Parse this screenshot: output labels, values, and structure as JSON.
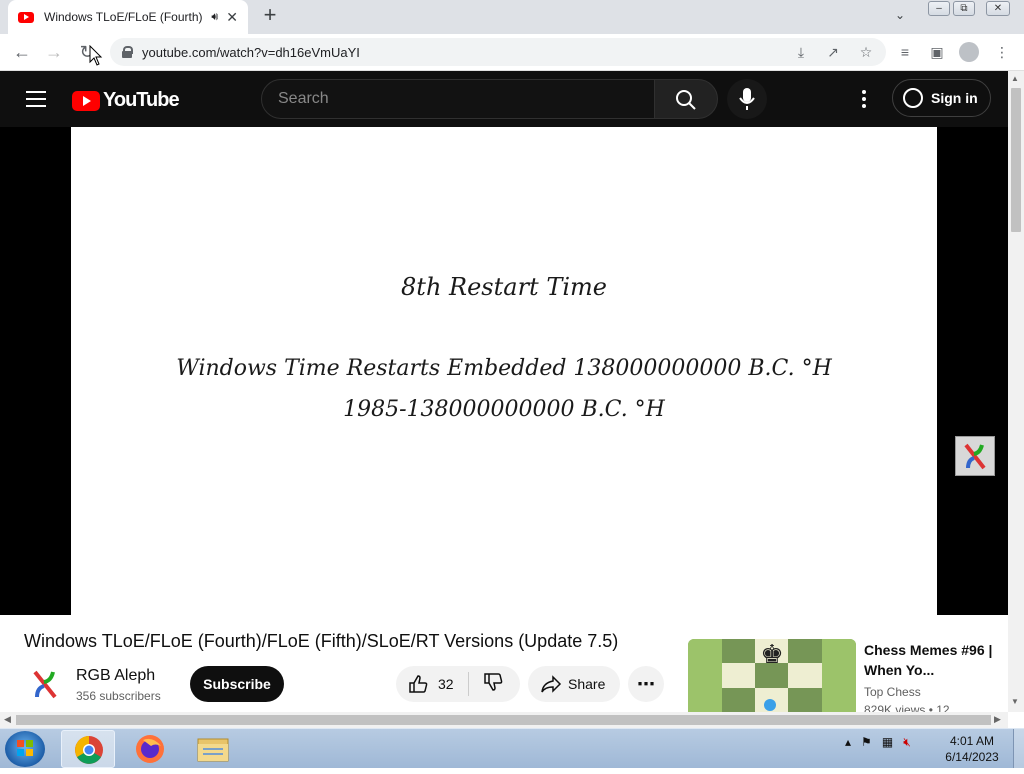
{
  "browser": {
    "tab_title": "Windows TLoE/FLoE (Fourth)",
    "new_tab": "+",
    "url": "youtube.com/watch?v=dh16eVmUaYI"
  },
  "youtube": {
    "logo_text": "YouTube",
    "search_placeholder": "Search",
    "sign_in": "Sign in",
    "brand_color": "#ff0000"
  },
  "video": {
    "slide_line1": "8th Restart Time",
    "slide_line2": "Windows Time Restarts Embedded 138000000000 B.C. °H",
    "slide_line3": "1985-138000000000 B.C. °H",
    "title": "Windows TLoE/FLoE (Fourth)/FLoE (Fifth)/SLoE/RT Versions (Update 7.5)",
    "channel_name": "RGB Aleph",
    "subscribers": "356 subscribers",
    "subscribe": "Subscribe",
    "likes": "32",
    "share": "Share"
  },
  "related": {
    "title": "Chess Memes #96 | When Yo...",
    "channel": "Top Chess",
    "views": "829K views • 12..."
  },
  "taskbar": {
    "time": "4:01 AM",
    "date": "6/14/2023"
  }
}
